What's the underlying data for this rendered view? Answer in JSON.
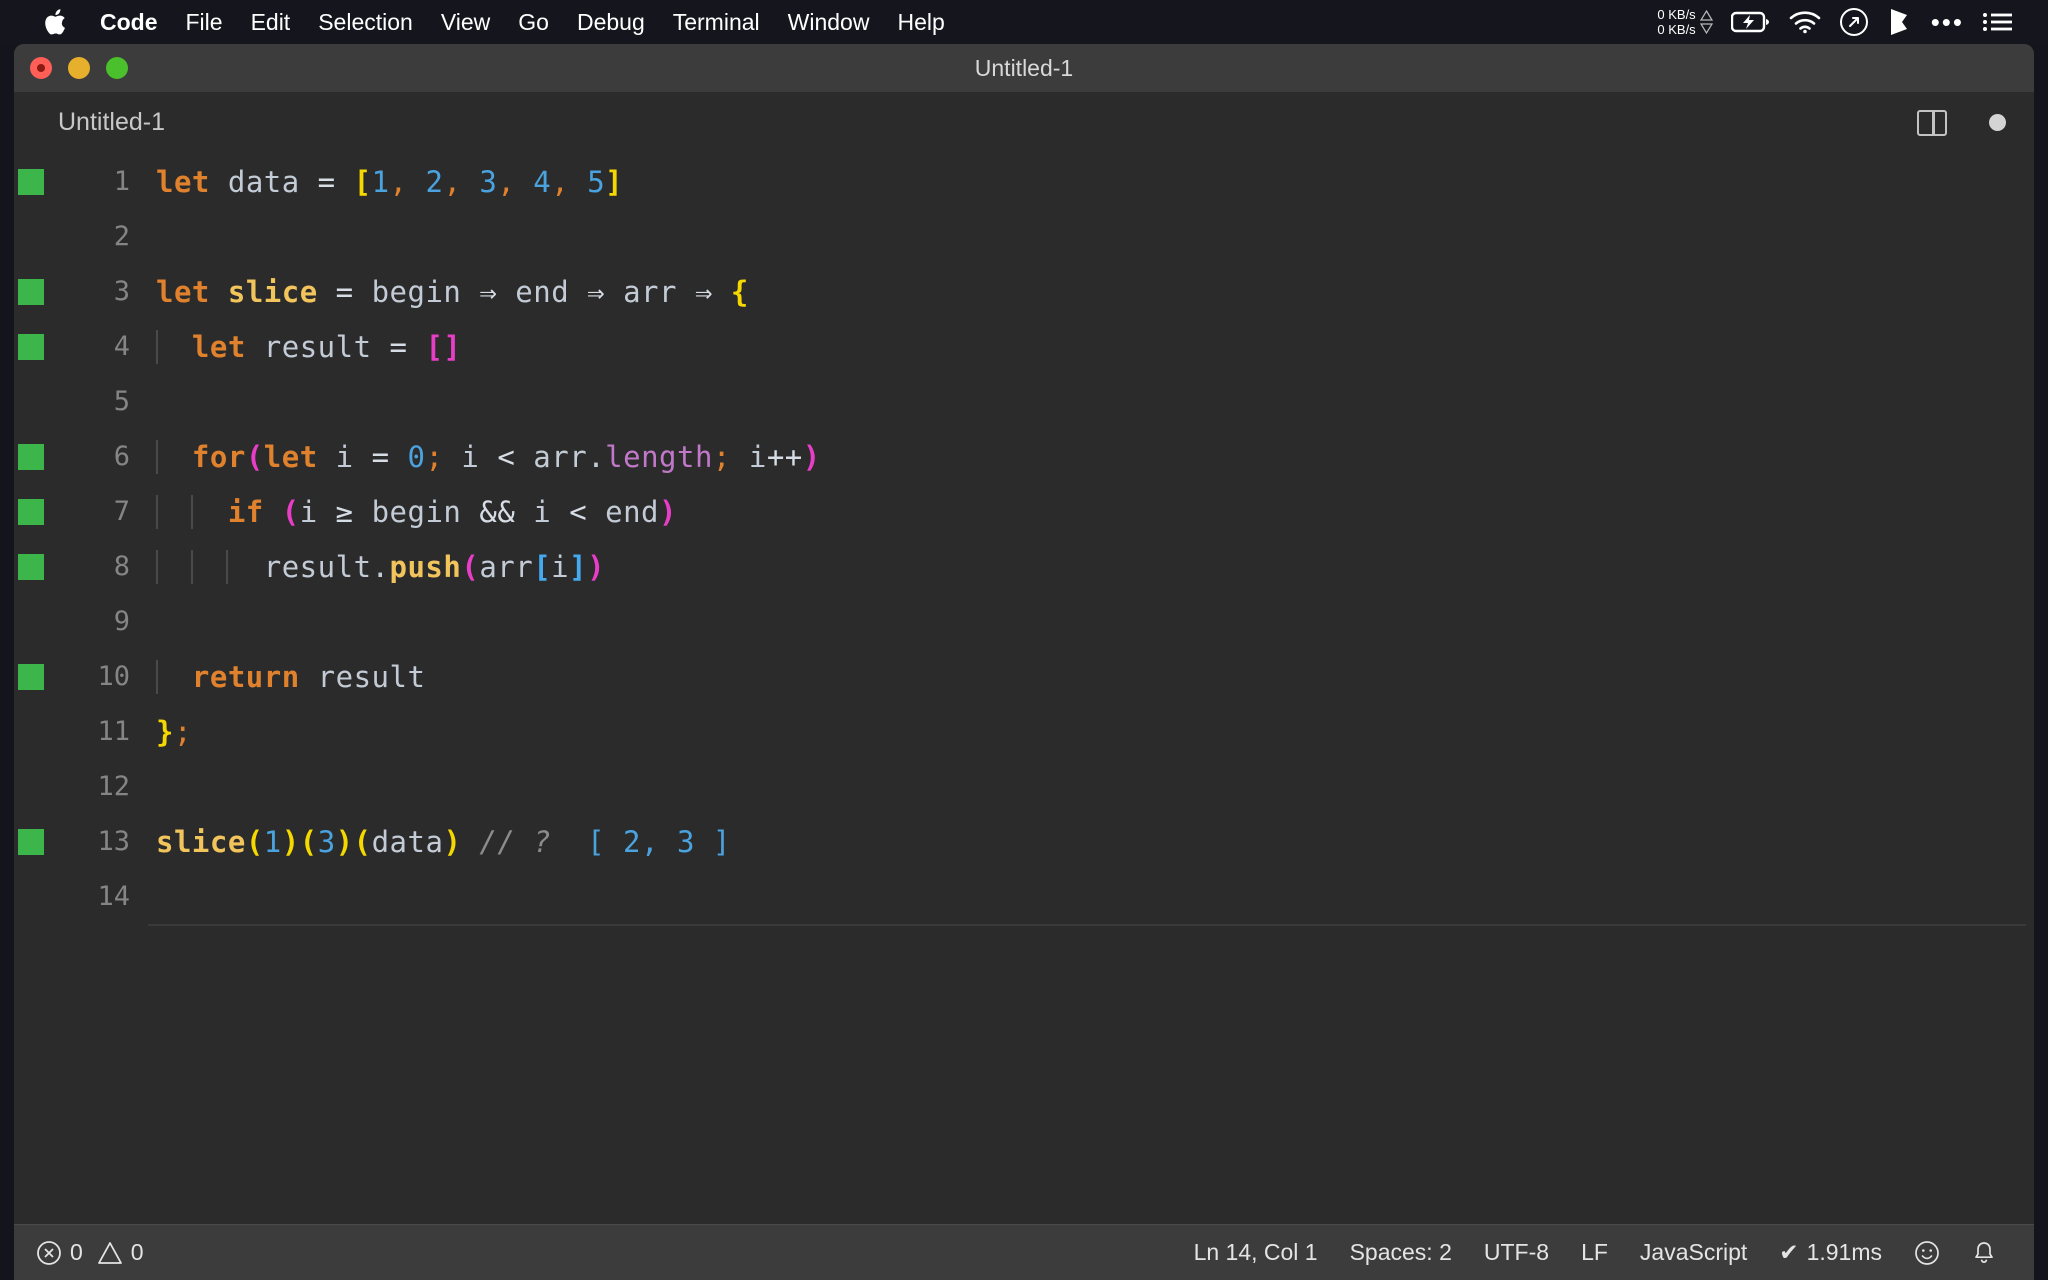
{
  "menubar": {
    "apple_icon": "apple-logo-icon",
    "items": [
      {
        "label": "Code",
        "bold": true
      },
      {
        "label": "File",
        "bold": false
      },
      {
        "label": "Edit",
        "bold": false
      },
      {
        "label": "Selection",
        "bold": false
      },
      {
        "label": "View",
        "bold": false
      },
      {
        "label": "Go",
        "bold": false
      },
      {
        "label": "Debug",
        "bold": false
      },
      {
        "label": "Terminal",
        "bold": false
      },
      {
        "label": "Window",
        "bold": false
      },
      {
        "label": "Help",
        "bold": false
      }
    ],
    "tray": {
      "net_up": "0 KB/s",
      "net_down": "0 KB/s",
      "up_arrow": "▲",
      "down_arrow": "▼",
      "icons": [
        "battery-charging-icon",
        "wifi-icon",
        "speedometer-icon",
        "shape-icon",
        "overflow-dots-icon",
        "control-center-icon"
      ],
      "dots": "•••"
    }
  },
  "window": {
    "title": "Untitled-1",
    "traffic_lights": [
      "close-button",
      "minimize-button",
      "zoom-button"
    ]
  },
  "tabbar": {
    "tab_label": "Untitled-1",
    "split_editor_icon": "split-editor-icon",
    "unsaved_dot": "unsaved-indicator"
  },
  "editor": {
    "lines": [
      {
        "num": "1",
        "marker": true,
        "indent": 0,
        "tokens": [
          {
            "t": "let",
            "c": "t-kw"
          },
          {
            "t": " ",
            "c": "t-op"
          },
          {
            "t": "data",
            "c": "t-var"
          },
          {
            "t": " ",
            "c": "t-op"
          },
          {
            "t": "=",
            "c": "t-op"
          },
          {
            "t": " ",
            "c": "t-op"
          },
          {
            "t": "[",
            "c": "t-br-y"
          },
          {
            "t": "1",
            "c": "t-num"
          },
          {
            "t": ",",
            "c": "t-punc"
          },
          {
            "t": " ",
            "c": "t-op"
          },
          {
            "t": "2",
            "c": "t-num"
          },
          {
            "t": ",",
            "c": "t-punc"
          },
          {
            "t": " ",
            "c": "t-op"
          },
          {
            "t": "3",
            "c": "t-num"
          },
          {
            "t": ",",
            "c": "t-punc"
          },
          {
            "t": " ",
            "c": "t-op"
          },
          {
            "t": "4",
            "c": "t-num"
          },
          {
            "t": ",",
            "c": "t-punc"
          },
          {
            "t": " ",
            "c": "t-op"
          },
          {
            "t": "5",
            "c": "t-num"
          },
          {
            "t": "]",
            "c": "t-br-y"
          }
        ]
      },
      {
        "num": "2",
        "marker": false,
        "indent": 0,
        "tokens": []
      },
      {
        "num": "3",
        "marker": true,
        "indent": 0,
        "tokens": [
          {
            "t": "let",
            "c": "t-kw"
          },
          {
            "t": " ",
            "c": "t-op"
          },
          {
            "t": "slice",
            "c": "t-fn"
          },
          {
            "t": " ",
            "c": "t-op"
          },
          {
            "t": "=",
            "c": "t-op"
          },
          {
            "t": " ",
            "c": "t-op"
          },
          {
            "t": "begin",
            "c": "t-var"
          },
          {
            "t": " ",
            "c": "t-op"
          },
          {
            "t": "⇒",
            "c": "t-op"
          },
          {
            "t": " ",
            "c": "t-op"
          },
          {
            "t": "end",
            "c": "t-var"
          },
          {
            "t": " ",
            "c": "t-op"
          },
          {
            "t": "⇒",
            "c": "t-op"
          },
          {
            "t": " ",
            "c": "t-op"
          },
          {
            "t": "arr",
            "c": "t-var"
          },
          {
            "t": " ",
            "c": "t-op"
          },
          {
            "t": "⇒",
            "c": "t-op"
          },
          {
            "t": " ",
            "c": "t-op"
          },
          {
            "t": "{",
            "c": "t-br-y"
          }
        ]
      },
      {
        "num": "4",
        "marker": true,
        "indent": 1,
        "tokens": [
          {
            "t": "  ",
            "c": "t-op"
          },
          {
            "t": "let",
            "c": "t-kw"
          },
          {
            "t": " ",
            "c": "t-op"
          },
          {
            "t": "result",
            "c": "t-var"
          },
          {
            "t": " ",
            "c": "t-op"
          },
          {
            "t": "=",
            "c": "t-op"
          },
          {
            "t": " ",
            "c": "t-op"
          },
          {
            "t": "[]",
            "c": "t-br-m"
          }
        ]
      },
      {
        "num": "5",
        "marker": false,
        "indent": 1,
        "tokens": []
      },
      {
        "num": "6",
        "marker": true,
        "indent": 1,
        "tokens": [
          {
            "t": "  ",
            "c": "t-op"
          },
          {
            "t": "for",
            "c": "t-kw"
          },
          {
            "t": "(",
            "c": "t-br-m"
          },
          {
            "t": "let",
            "c": "t-kw"
          },
          {
            "t": " ",
            "c": "t-op"
          },
          {
            "t": "i",
            "c": "t-var"
          },
          {
            "t": " ",
            "c": "t-op"
          },
          {
            "t": "=",
            "c": "t-op"
          },
          {
            "t": " ",
            "c": "t-op"
          },
          {
            "t": "0",
            "c": "t-num"
          },
          {
            "t": ";",
            "c": "t-punc"
          },
          {
            "t": " ",
            "c": "t-op"
          },
          {
            "t": "i",
            "c": "t-var"
          },
          {
            "t": " ",
            "c": "t-op"
          },
          {
            "t": "<",
            "c": "t-op"
          },
          {
            "t": " ",
            "c": "t-op"
          },
          {
            "t": "arr",
            "c": "t-var"
          },
          {
            "t": ".",
            "c": "t-var"
          },
          {
            "t": "length",
            "c": "t-prop"
          },
          {
            "t": ";",
            "c": "t-punc"
          },
          {
            "t": " ",
            "c": "t-op"
          },
          {
            "t": "i",
            "c": "t-var"
          },
          {
            "t": "++",
            "c": "t-op"
          },
          {
            "t": ")",
            "c": "t-br-m"
          }
        ]
      },
      {
        "num": "7",
        "marker": true,
        "indent": 2,
        "tokens": [
          {
            "t": "    ",
            "c": "t-op"
          },
          {
            "t": "if",
            "c": "t-kw"
          },
          {
            "t": " ",
            "c": "t-op"
          },
          {
            "t": "(",
            "c": "t-br-m"
          },
          {
            "t": "i",
            "c": "t-var"
          },
          {
            "t": " ",
            "c": "t-op"
          },
          {
            "t": "≥",
            "c": "t-op"
          },
          {
            "t": " ",
            "c": "t-op"
          },
          {
            "t": "begin",
            "c": "t-var"
          },
          {
            "t": " ",
            "c": "t-op"
          },
          {
            "t": "&&",
            "c": "t-op"
          },
          {
            "t": " ",
            "c": "t-op"
          },
          {
            "t": "i",
            "c": "t-var"
          },
          {
            "t": " ",
            "c": "t-op"
          },
          {
            "t": "<",
            "c": "t-op"
          },
          {
            "t": " ",
            "c": "t-op"
          },
          {
            "t": "end",
            "c": "t-var"
          },
          {
            "t": ")",
            "c": "t-br-m"
          }
        ]
      },
      {
        "num": "8",
        "marker": true,
        "indent": 3,
        "tokens": [
          {
            "t": "      ",
            "c": "t-op"
          },
          {
            "t": "result",
            "c": "t-var"
          },
          {
            "t": ".",
            "c": "t-var"
          },
          {
            "t": "push",
            "c": "t-fn"
          },
          {
            "t": "(",
            "c": "t-br-m"
          },
          {
            "t": "arr",
            "c": "t-var"
          },
          {
            "t": "[",
            "c": "t-br-b"
          },
          {
            "t": "i",
            "c": "t-var"
          },
          {
            "t": "]",
            "c": "t-br-b"
          },
          {
            "t": ")",
            "c": "t-br-m"
          }
        ]
      },
      {
        "num": "9",
        "marker": false,
        "indent": 1,
        "tokens": []
      },
      {
        "num": "10",
        "marker": true,
        "indent": 1,
        "tokens": [
          {
            "t": "  ",
            "c": "t-op"
          },
          {
            "t": "return",
            "c": "t-kw"
          },
          {
            "t": " ",
            "c": "t-op"
          },
          {
            "t": "result",
            "c": "t-var"
          }
        ]
      },
      {
        "num": "11",
        "marker": false,
        "indent": 0,
        "tokens": [
          {
            "t": "}",
            "c": "t-br-y"
          },
          {
            "t": ";",
            "c": "t-punc"
          }
        ]
      },
      {
        "num": "12",
        "marker": false,
        "indent": 0,
        "tokens": []
      },
      {
        "num": "13",
        "marker": true,
        "indent": 0,
        "tokens": [
          {
            "t": "slice",
            "c": "t-fn"
          },
          {
            "t": "(",
            "c": "t-br-y"
          },
          {
            "t": "1",
            "c": "t-num"
          },
          {
            "t": ")",
            "c": "t-br-y"
          },
          {
            "t": "(",
            "c": "t-br-y"
          },
          {
            "t": "3",
            "c": "t-num"
          },
          {
            "t": ")",
            "c": "t-br-y"
          },
          {
            "t": "(",
            "c": "t-br-y"
          },
          {
            "t": "data",
            "c": "t-var"
          },
          {
            "t": ")",
            "c": "t-br-y"
          },
          {
            "t": " ",
            "c": "t-op"
          },
          {
            "t": "// ?",
            "c": "t-com"
          },
          {
            "t": "  ",
            "c": "t-op"
          },
          {
            "t": "[ 2, 3 ]",
            "c": "t-num"
          }
        ]
      },
      {
        "num": "14",
        "marker": false,
        "indent": 0,
        "tokens": [],
        "cursorline": true
      }
    ]
  },
  "statusbar": {
    "errors": "0",
    "warnings": "0",
    "error_icon": "error-circle-icon",
    "warning_icon": "warning-triangle-icon",
    "cursor_position": "Ln 14, Col 1",
    "indentation": "Spaces: 2",
    "encoding": "UTF-8",
    "eol": "LF",
    "language": "JavaScript",
    "timing": "1.91ms",
    "timing_check": "✔",
    "smiley_icon": "feedback-smiley-icon",
    "bell_icon": "notifications-bell-icon"
  }
}
